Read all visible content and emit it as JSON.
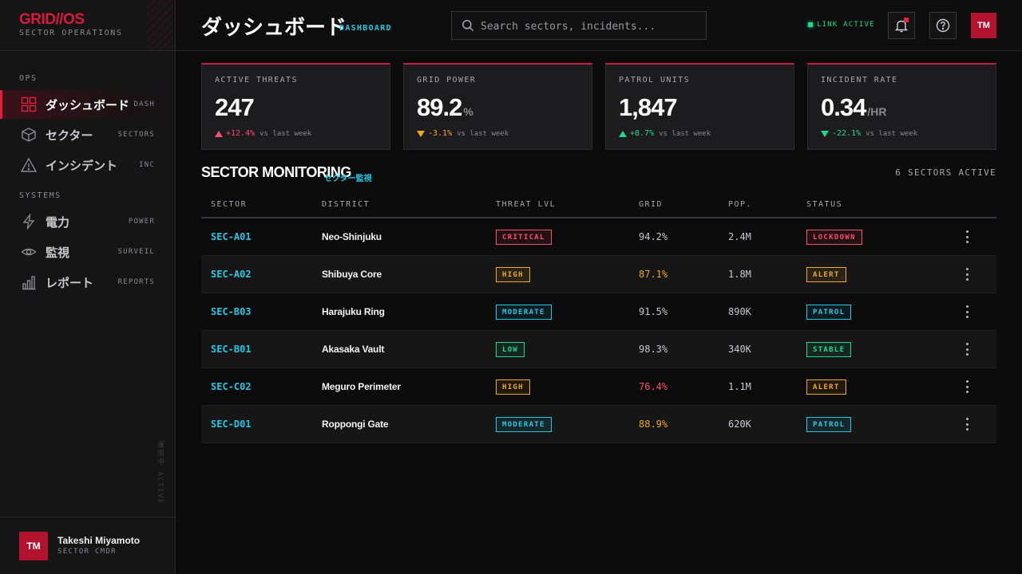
{
  "colors": {
    "accent_red": "#e0203f",
    "accent_cyan": "#22c9e6",
    "accent_green": "#1ed98a",
    "accent_amber": "#f0a825",
    "critical_pink": "#ff4d6d"
  },
  "brand": {
    "name": "GRID//OS",
    "subtitle": "SECTOR OPERATIONS"
  },
  "sidebar": {
    "sections": [
      {
        "label": "OPS"
      },
      {
        "label": "SYSTEMS"
      }
    ],
    "items": [
      {
        "label": "ダッシュボード",
        "code": "DASH",
        "icon": "dashboard-grid-icon",
        "active": true
      },
      {
        "label": "セクター",
        "code": "SECTORS",
        "icon": "cube-icon",
        "active": false
      },
      {
        "label": "インシデント",
        "code": "INC",
        "icon": "warning-triangle-icon",
        "active": false
      },
      {
        "label": "電力",
        "code": "POWER",
        "icon": "lightning-icon",
        "active": false
      },
      {
        "label": "監視",
        "code": "SURVEIL",
        "icon": "eye-icon",
        "active": false
      },
      {
        "label": "レポート",
        "code": "REPORTS",
        "icon": "bar-chart-icon",
        "active": false
      }
    ],
    "vertical_text": "運用中 ACTIVE",
    "user": {
      "initials": "TM",
      "name": "Takeshi Miyamoto",
      "role": "SECTOR CMDR"
    }
  },
  "header": {
    "title": "ダッシュボード",
    "tag": "DASHBOARD",
    "search_placeholder": "Search sectors, incidents...",
    "link_status": "LINK ACTIVE",
    "avatar_initials": "TM"
  },
  "stats": [
    {
      "label": "ACTIVE THREATS",
      "value": "247",
      "unit": "",
      "delta": "+12.4%",
      "direction": "up",
      "delta_color": "#ff4d6d",
      "context": "vs last week"
    },
    {
      "label": "GRID POWER",
      "value": "89.2",
      "unit": "%",
      "delta": "-3.1%",
      "direction": "down",
      "delta_color": "#f0a825",
      "context": "vs last week"
    },
    {
      "label": "PATROL UNITS",
      "value": "1,847",
      "unit": "",
      "delta": "+8.7%",
      "direction": "up",
      "delta_color": "#1ed98a",
      "context": "vs last week"
    },
    {
      "label": "INCIDENT RATE",
      "value": "0.34",
      "unit": "/HR",
      "delta": "-22.1%",
      "direction": "down",
      "delta_color": "#1ed98a",
      "context": "vs last week"
    }
  ],
  "monitoring": {
    "title": "SECTOR MONITORING",
    "subtitle": "セクター監視",
    "count_text": "6 SECTORS ACTIVE",
    "columns": [
      "SECTOR",
      "DISTRICT",
      "THREAT LVL",
      "GRID",
      "POP.",
      "STATUS"
    ],
    "rows": [
      {
        "sector": "SEC-A01",
        "district": "Neo-Shinjuku",
        "threat": "CRITICAL",
        "threat_color": "#ff4d6d",
        "grid": "94.2%",
        "grid_color": "#c8c8cc",
        "pop": "2.4M",
        "status": "LOCKDOWN",
        "status_color": "#ff4d6d"
      },
      {
        "sector": "SEC-A02",
        "district": "Shibuya Core",
        "threat": "HIGH",
        "threat_color": "#f0a825",
        "grid": "87.1%",
        "grid_color": "#f0a825",
        "pop": "1.8M",
        "status": "ALERT",
        "status_color": "#f0a825"
      },
      {
        "sector": "SEC-B03",
        "district": "Harajuku Ring",
        "threat": "MODERATE",
        "threat_color": "#22c9e6",
        "grid": "91.5%",
        "grid_color": "#c8c8cc",
        "pop": "890K",
        "status": "PATROL",
        "status_color": "#22c9e6"
      },
      {
        "sector": "SEC-B01",
        "district": "Akasaka Vault",
        "threat": "LOW",
        "threat_color": "#1ed98a",
        "grid": "98.3%",
        "grid_color": "#c8c8cc",
        "pop": "340K",
        "status": "STABLE",
        "status_color": "#1ed98a"
      },
      {
        "sector": "SEC-C02",
        "district": "Meguro Perimeter",
        "threat": "HIGH",
        "threat_color": "#f0a825",
        "grid": "76.4%",
        "grid_color": "#ff4d6d",
        "pop": "1.1M",
        "status": "ALERT",
        "status_color": "#f0a825"
      },
      {
        "sector": "SEC-D01",
        "district": "Roppongi Gate",
        "threat": "MODERATE",
        "threat_color": "#22c9e6",
        "grid": "88.9%",
        "grid_color": "#f0a825",
        "pop": "620K",
        "status": "PATROL",
        "status_color": "#22c9e6"
      }
    ]
  }
}
